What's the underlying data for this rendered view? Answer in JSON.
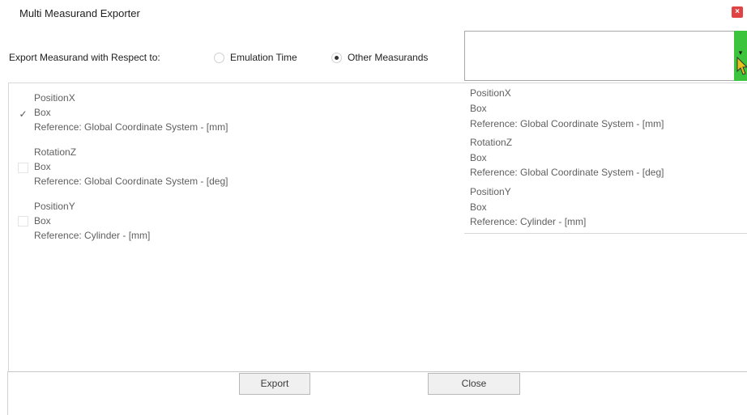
{
  "window": {
    "title": "Multi Measurand Exporter",
    "close_glyph": "×"
  },
  "export_row": {
    "label": "Export Measurand with Respect to:",
    "options": [
      {
        "label": "Emulation Time",
        "selected": false
      },
      {
        "label": "Other Measurands",
        "selected": true
      }
    ],
    "dropdown_value": "",
    "dropdown_arrow_icon": "chevron-down-icon",
    "dropdown_arrow_color": "#3cc43c"
  },
  "left_list": [
    {
      "name": "PositionX",
      "object": "Box",
      "reference": "Reference: Global Coordinate System - [mm]",
      "checked": true
    },
    {
      "name": "RotationZ",
      "object": "Box",
      "reference": "Reference: Global Coordinate System - [deg]",
      "checked": false
    },
    {
      "name": "PositionY",
      "object": "Box",
      "reference": "Reference: Cylinder  - [mm]",
      "checked": false
    }
  ],
  "right_list": [
    {
      "name": "PositionX",
      "object": "Box",
      "reference": "Reference: Global Coordinate System - [mm]"
    },
    {
      "name": "RotationZ",
      "object": "Box",
      "reference": "Reference: Global Coordinate System - [deg]"
    },
    {
      "name": "PositionY",
      "object": "Box",
      "reference": "Reference: Cylinder  - [mm]"
    }
  ],
  "buttons": {
    "export": "Export",
    "close": "Close"
  },
  "colors": {
    "close_button": "#e04343",
    "accent_green": "#3cc43c",
    "text_muted": "#5f5f5f"
  }
}
